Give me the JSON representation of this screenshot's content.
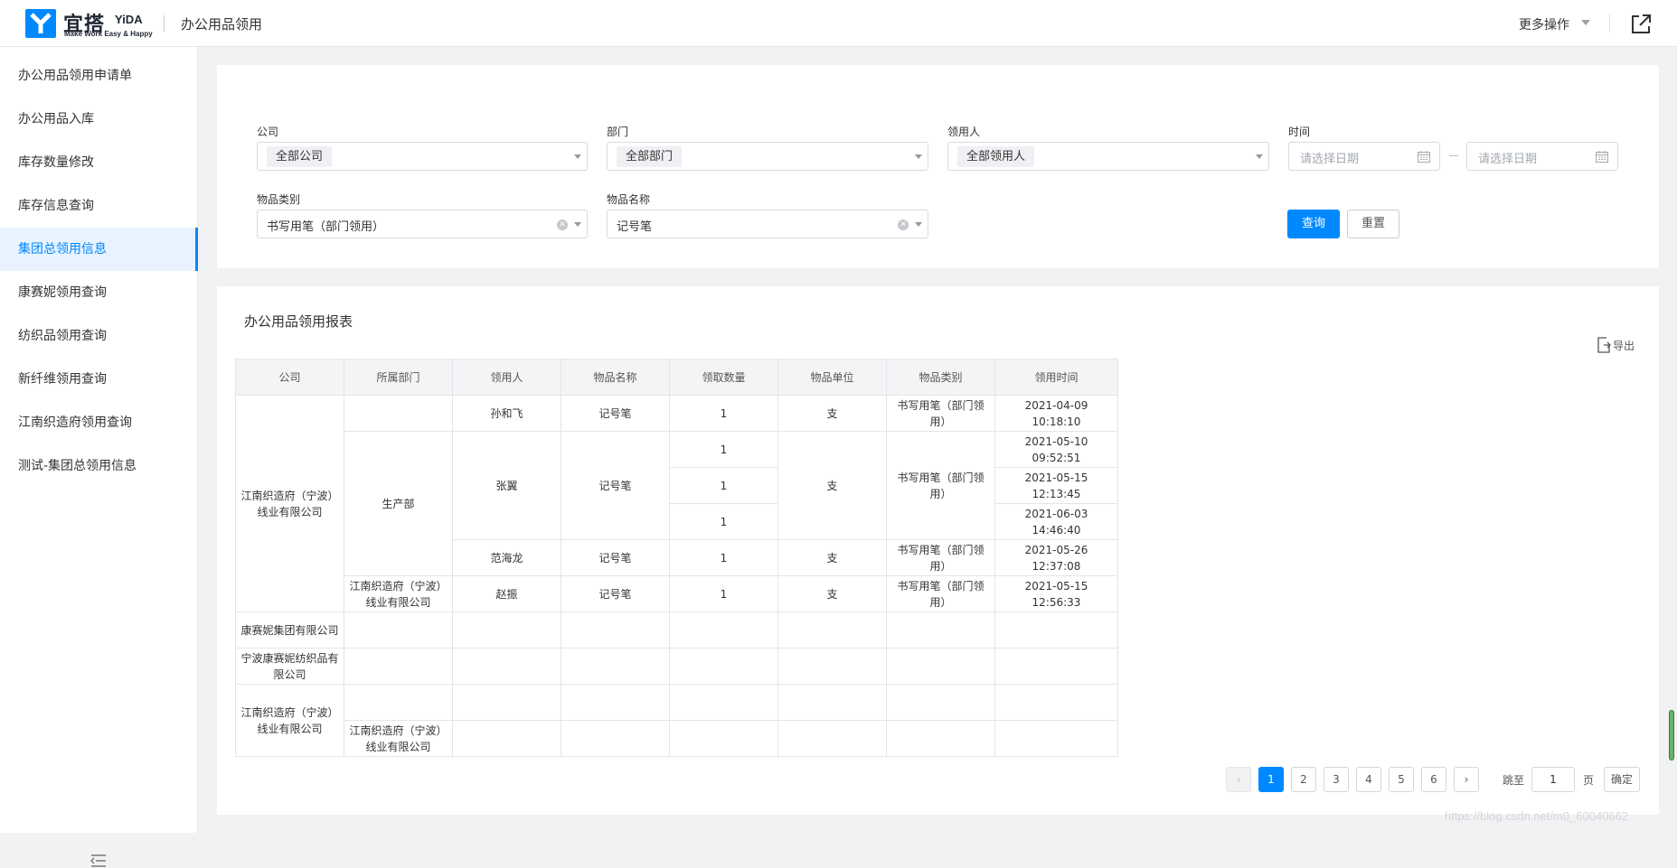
{
  "header": {
    "brand_cn": "宜搭",
    "brand_en": "YiDA",
    "slogan": "Make Work Easy & Happy",
    "app_title": "办公用品领用",
    "more_label": "更多操作"
  },
  "sidebar": {
    "items": [
      {
        "label": "办公用品领用申请单"
      },
      {
        "label": "办公用品入库"
      },
      {
        "label": "库存数量修改"
      },
      {
        "label": "库存信息查询"
      },
      {
        "label": "集团总领用信息",
        "active": true
      },
      {
        "label": "康赛妮领用查询"
      },
      {
        "label": "纺织品领用查询"
      },
      {
        "label": "新纤维领用查询"
      },
      {
        "label": "江南织造府领用查询"
      },
      {
        "label": "测试-集团总领用信息"
      }
    ]
  },
  "filters": {
    "company": {
      "label": "公司",
      "value": "全部公司"
    },
    "department": {
      "label": "部门",
      "value": "全部部门"
    },
    "recipient": {
      "label": "领用人",
      "value": "全部领用人"
    },
    "time": {
      "label": "时间",
      "start_placeholder": "请选择日期",
      "end_placeholder": "请选择日期"
    },
    "category": {
      "label": "物品类别",
      "value": "书写用笔（部门领用）"
    },
    "item_name": {
      "label": "物品名称",
      "value": "记号笔"
    },
    "query_label": "查询",
    "reset_label": "重置"
  },
  "report": {
    "title": "办公用品领用报表",
    "export_label": "导出",
    "columns": [
      "公司",
      "所属部门",
      "领用人",
      "物品名称",
      "领取数量",
      "物品单位",
      "物品类别",
      "领用时间"
    ],
    "cells": {
      "company1": "江南织造府（宁波）线业有限公司",
      "dept_production": "生产部",
      "dept_jn": "江南织造府（宁波）线业有限公司",
      "r1_person": "孙和飞",
      "r1_item": "记号笔",
      "r1_qty": "1",
      "r1_unit": "支",
      "r1_cat": "书写用笔（部门领用）",
      "r1_time": "2021-04-09 10:18:10",
      "g2_person": "张翼",
      "g2_item": "记号笔",
      "g2_unit": "支",
      "g2_cat": "书写用笔（部门领用）",
      "r2_qty": "1",
      "r2_time": "2021-05-10 09:52:51",
      "r3_qty": "1",
      "r3_time": "2021-05-15 12:13:45",
      "r4_qty": "1",
      "r4_time": "2021-06-03 14:46:40",
      "r5_person": "范海龙",
      "r5_item": "记号笔",
      "r5_qty": "1",
      "r5_unit": "支",
      "r5_cat": "书写用笔（部门领用）",
      "r5_time": "2021-05-26 12:37:08",
      "r6_person": "赵振",
      "r6_item": "记号笔",
      "r6_qty": "1",
      "r6_unit": "支",
      "r6_cat": "书写用笔（部门领用）",
      "r6_time": "2021-05-15 12:56:33",
      "company2": "康赛妮集团有限公司",
      "company3": "宁波康赛妮纺织品有限公司",
      "company4": "江南织造府（宁波）线业有限公司",
      "c4_dept": "江南织造府（宁波）线业有限公司"
    }
  },
  "pagination": {
    "prev": "‹",
    "next": "›",
    "pages": [
      "1",
      "2",
      "3",
      "4",
      "5",
      "6"
    ],
    "current": "1",
    "jump_label": "跳至",
    "jump_value": "1",
    "page_suffix": "页",
    "confirm_label": "确定"
  },
  "watermark": "https://blog.csdn.net/m0_60040662"
}
